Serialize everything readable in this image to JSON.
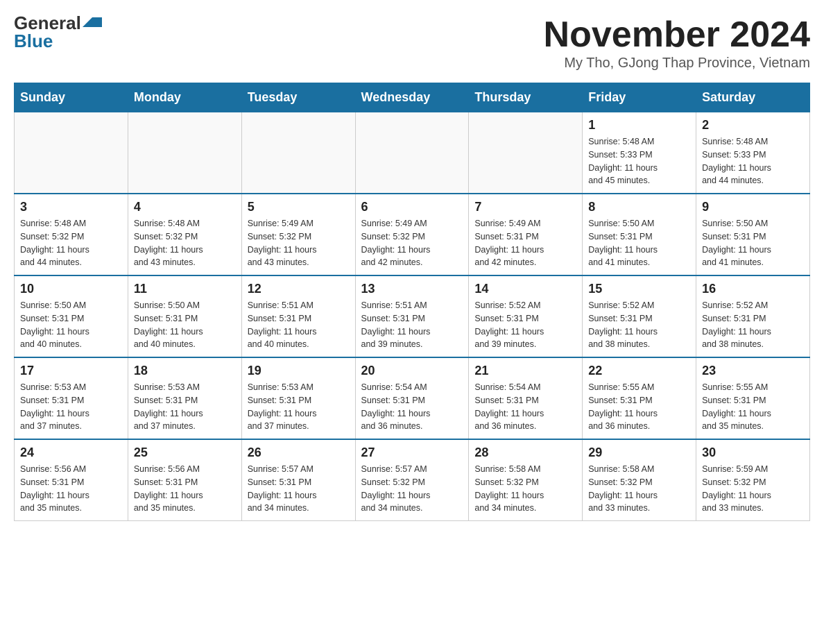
{
  "logo": {
    "general": "General",
    "blue": "Blue"
  },
  "title": "November 2024",
  "location": "My Tho, GJong Thap Province, Vietnam",
  "days_of_week": [
    "Sunday",
    "Monday",
    "Tuesday",
    "Wednesday",
    "Thursday",
    "Friday",
    "Saturday"
  ],
  "weeks": [
    [
      {
        "day": "",
        "info": ""
      },
      {
        "day": "",
        "info": ""
      },
      {
        "day": "",
        "info": ""
      },
      {
        "day": "",
        "info": ""
      },
      {
        "day": "",
        "info": ""
      },
      {
        "day": "1",
        "info": "Sunrise: 5:48 AM\nSunset: 5:33 PM\nDaylight: 11 hours\nand 45 minutes."
      },
      {
        "day": "2",
        "info": "Sunrise: 5:48 AM\nSunset: 5:33 PM\nDaylight: 11 hours\nand 44 minutes."
      }
    ],
    [
      {
        "day": "3",
        "info": "Sunrise: 5:48 AM\nSunset: 5:32 PM\nDaylight: 11 hours\nand 44 minutes."
      },
      {
        "day": "4",
        "info": "Sunrise: 5:48 AM\nSunset: 5:32 PM\nDaylight: 11 hours\nand 43 minutes."
      },
      {
        "day": "5",
        "info": "Sunrise: 5:49 AM\nSunset: 5:32 PM\nDaylight: 11 hours\nand 43 minutes."
      },
      {
        "day": "6",
        "info": "Sunrise: 5:49 AM\nSunset: 5:32 PM\nDaylight: 11 hours\nand 42 minutes."
      },
      {
        "day": "7",
        "info": "Sunrise: 5:49 AM\nSunset: 5:31 PM\nDaylight: 11 hours\nand 42 minutes."
      },
      {
        "day": "8",
        "info": "Sunrise: 5:50 AM\nSunset: 5:31 PM\nDaylight: 11 hours\nand 41 minutes."
      },
      {
        "day": "9",
        "info": "Sunrise: 5:50 AM\nSunset: 5:31 PM\nDaylight: 11 hours\nand 41 minutes."
      }
    ],
    [
      {
        "day": "10",
        "info": "Sunrise: 5:50 AM\nSunset: 5:31 PM\nDaylight: 11 hours\nand 40 minutes."
      },
      {
        "day": "11",
        "info": "Sunrise: 5:50 AM\nSunset: 5:31 PM\nDaylight: 11 hours\nand 40 minutes."
      },
      {
        "day": "12",
        "info": "Sunrise: 5:51 AM\nSunset: 5:31 PM\nDaylight: 11 hours\nand 40 minutes."
      },
      {
        "day": "13",
        "info": "Sunrise: 5:51 AM\nSunset: 5:31 PM\nDaylight: 11 hours\nand 39 minutes."
      },
      {
        "day": "14",
        "info": "Sunrise: 5:52 AM\nSunset: 5:31 PM\nDaylight: 11 hours\nand 39 minutes."
      },
      {
        "day": "15",
        "info": "Sunrise: 5:52 AM\nSunset: 5:31 PM\nDaylight: 11 hours\nand 38 minutes."
      },
      {
        "day": "16",
        "info": "Sunrise: 5:52 AM\nSunset: 5:31 PM\nDaylight: 11 hours\nand 38 minutes."
      }
    ],
    [
      {
        "day": "17",
        "info": "Sunrise: 5:53 AM\nSunset: 5:31 PM\nDaylight: 11 hours\nand 37 minutes."
      },
      {
        "day": "18",
        "info": "Sunrise: 5:53 AM\nSunset: 5:31 PM\nDaylight: 11 hours\nand 37 minutes."
      },
      {
        "day": "19",
        "info": "Sunrise: 5:53 AM\nSunset: 5:31 PM\nDaylight: 11 hours\nand 37 minutes."
      },
      {
        "day": "20",
        "info": "Sunrise: 5:54 AM\nSunset: 5:31 PM\nDaylight: 11 hours\nand 36 minutes."
      },
      {
        "day": "21",
        "info": "Sunrise: 5:54 AM\nSunset: 5:31 PM\nDaylight: 11 hours\nand 36 minutes."
      },
      {
        "day": "22",
        "info": "Sunrise: 5:55 AM\nSunset: 5:31 PM\nDaylight: 11 hours\nand 36 minutes."
      },
      {
        "day": "23",
        "info": "Sunrise: 5:55 AM\nSunset: 5:31 PM\nDaylight: 11 hours\nand 35 minutes."
      }
    ],
    [
      {
        "day": "24",
        "info": "Sunrise: 5:56 AM\nSunset: 5:31 PM\nDaylight: 11 hours\nand 35 minutes."
      },
      {
        "day": "25",
        "info": "Sunrise: 5:56 AM\nSunset: 5:31 PM\nDaylight: 11 hours\nand 35 minutes."
      },
      {
        "day": "26",
        "info": "Sunrise: 5:57 AM\nSunset: 5:31 PM\nDaylight: 11 hours\nand 34 minutes."
      },
      {
        "day": "27",
        "info": "Sunrise: 5:57 AM\nSunset: 5:32 PM\nDaylight: 11 hours\nand 34 minutes."
      },
      {
        "day": "28",
        "info": "Sunrise: 5:58 AM\nSunset: 5:32 PM\nDaylight: 11 hours\nand 34 minutes."
      },
      {
        "day": "29",
        "info": "Sunrise: 5:58 AM\nSunset: 5:32 PM\nDaylight: 11 hours\nand 33 minutes."
      },
      {
        "day": "30",
        "info": "Sunrise: 5:59 AM\nSunset: 5:32 PM\nDaylight: 11 hours\nand 33 minutes."
      }
    ]
  ]
}
